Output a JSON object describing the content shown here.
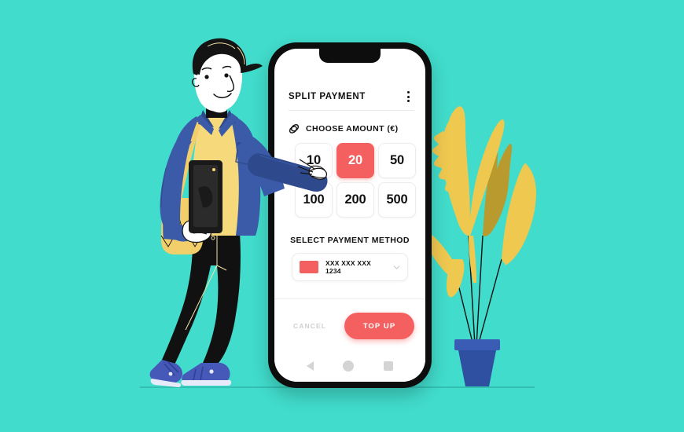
{
  "scene": {
    "background_color": "#41dccb",
    "ground_line_color": "#2fb7a8"
  },
  "phone": {
    "frame_color": "#0d0d0d",
    "screen_color": "#ffffff",
    "notch": "notch"
  },
  "app": {
    "title": "SPLIT PAYMENT",
    "menu_icon": "kebab-menu-icon",
    "amount_section": {
      "icon": "coin-icon",
      "label": "CHOOSE AMOUNT (€)",
      "options": [
        {
          "value": "10",
          "selected": false
        },
        {
          "value": "20",
          "selected": true
        },
        {
          "value": "50",
          "selected": false
        },
        {
          "value": "100",
          "selected": false
        },
        {
          "value": "200",
          "selected": false
        },
        {
          "value": "500",
          "selected": false
        }
      ],
      "selected_value": "20",
      "selected_color": "#f4605f"
    },
    "payment_method": {
      "label": "SELECT PAYMENT METHOD",
      "card_number": "XXX XXX XXX 1234",
      "card_color": "#f4605f",
      "chevron_icon": "chevron-down-icon"
    },
    "actions": {
      "cancel_label": "CANCEL",
      "cancel_color": "#cfcfcf",
      "topup_label": "TOP UP",
      "topup_color": "#f4605f"
    },
    "navbar": {
      "back_icon": "triangle-back-icon",
      "home_icon": "circle-home-icon",
      "recents_icon": "square-recents-icon",
      "icon_color": "#d4d4d4"
    }
  },
  "illustration": {
    "character": {
      "name": "man-holding-phone",
      "hair_color": "#141414",
      "skin_color": "#ffffff",
      "jacket_color": "#3b5ba9",
      "jacket_dark_color": "#2f4a8c",
      "shirt_color": "#f5d97a",
      "bag_color": "#f2cf6b",
      "pants_color": "#111111",
      "shoes_color": "#4759b8",
      "phone_color": "#1a1a1a"
    },
    "plant": {
      "name": "potted-plant",
      "leaf_color": "#efc84f",
      "leaf_dark_color": "#b99a2e",
      "pot_color": "#2f4fa0",
      "pot_rim_color": "#3a5cb4"
    }
  }
}
